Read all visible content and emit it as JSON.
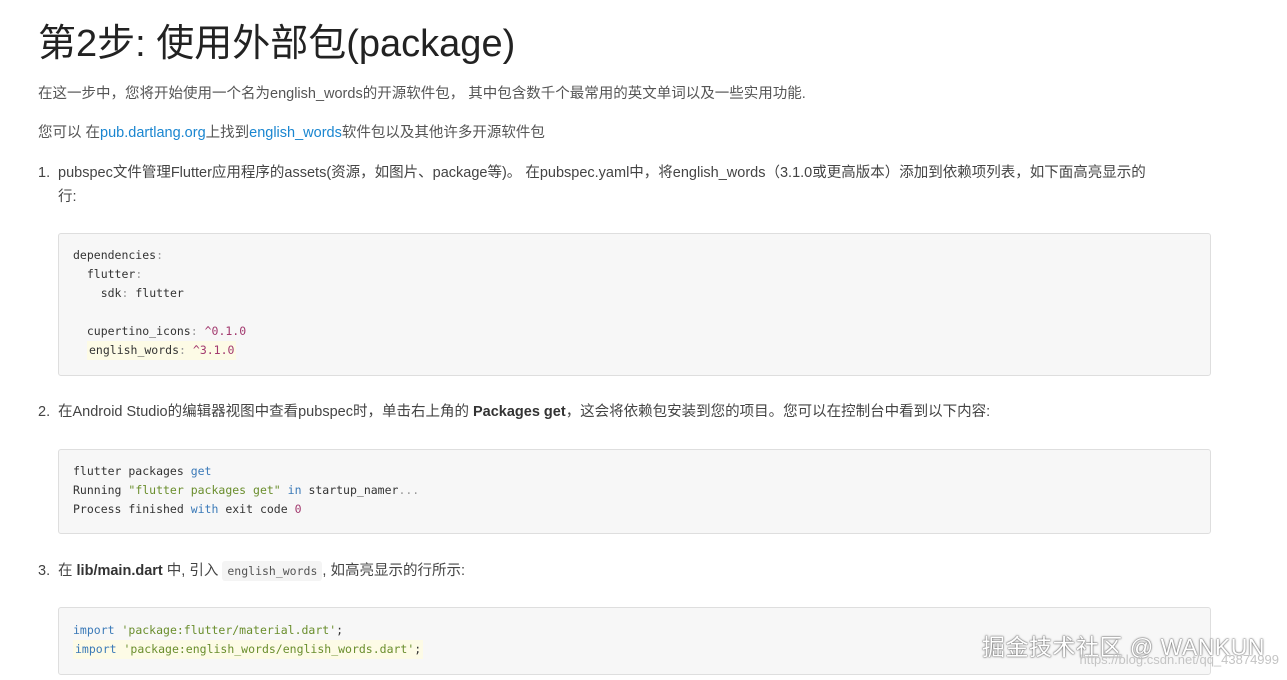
{
  "title": "第2步: 使用外部包(package)",
  "intro": "在这一步中，您将开始使用一个名为english_words的开源软件包， 其中包含数千个最常用的英文单词以及一些实用功能.",
  "find": {
    "prefix": "您可以 在",
    "link1": "pub.dartlang.org",
    "middle": "上找到",
    "link2": "english_words",
    "suffix": "软件包以及其他许多开源软件包"
  },
  "steps": [
    {
      "num": "1.",
      "text_line1": "pubspec文件管理Flutter应用程序的assets(资源，如图片、package等)。 在pubspec.yaml中，将english_words（3.1.0或更高版本）添加到依赖项列表，如下面高亮显示的",
      "text_line2": "行:"
    },
    {
      "num": "2.",
      "text_a": "在Android Studio的编辑器视图中查看pubspec时，单击右上角的 ",
      "bold": "Packages get",
      "text_b": "，这会将依赖包安装到您的项目。您可以在控制台中看到以下内容:"
    },
    {
      "num": "3.",
      "text_a": "在 ",
      "bold": "lib/main.dart",
      "text_b": " 中, 引入 ",
      "inline_code": "english_words",
      "text_c": ", 如高亮显示的行所示:"
    }
  ],
  "code1": {
    "l1": "dependencies",
    "l2": "flutter",
    "l3a": "sdk",
    "l3b": "flutter",
    "l4a": "cupertino_icons",
    "l4b": "^0.1.0",
    "l5a": "english_words",
    "l5b": "^3.1.0",
    "colon": ":"
  },
  "code2": {
    "l1a": "flutter packages ",
    "l1b": "get",
    "l2a": "Running ",
    "l2b": "\"flutter packages get\"",
    "l2c": " ",
    "l2d": "in",
    "l2e": " startup_namer",
    "l2f": "...",
    "l3a": "Process finished ",
    "l3b": "with",
    "l3c": " exit code ",
    "l3d": "0"
  },
  "code3": {
    "kw": "import",
    "l1": "'package:flutter/material.dart'",
    "l2": "'package:english_words/english_words.dart'",
    "semi": ";"
  },
  "watermark": "掘金技术社区 @ WANKUN",
  "watermark_url": "https://blog.csdn.net/qq_43874999"
}
